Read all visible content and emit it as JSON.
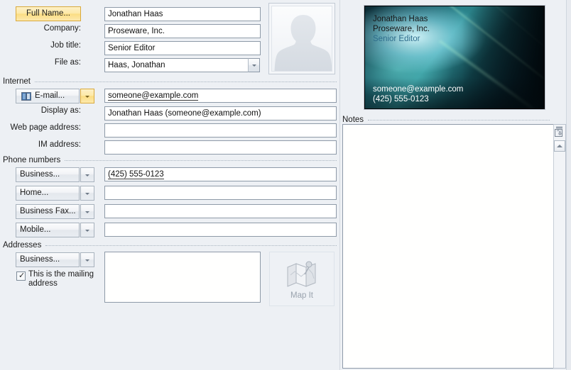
{
  "form": {
    "name_button": "Full Name...",
    "name_value": "Jonathan Haas",
    "company_label": "Company:",
    "company_value": "Proseware, Inc.",
    "jobtitle_label": "Job title:",
    "jobtitle_value": "Senior Editor",
    "fileas_label": "File as:",
    "fileas_value": "Haas, Jonathan"
  },
  "internet": {
    "section_label": "Internet",
    "email_button": "E-mail...",
    "email_icon": "address-book-icon",
    "email_value": "someone@example.com",
    "displayas_label": "Display as:",
    "displayas_value": "Jonathan Haas (someone@example.com)",
    "webpage_label": "Web page address:",
    "webpage_value": "",
    "im_label": "IM address:",
    "im_value": ""
  },
  "phones": {
    "section_label": "Phone numbers",
    "rows": [
      {
        "type": "Business...",
        "value": "(425) 555-0123",
        "smarttag": true
      },
      {
        "type": "Home...",
        "value": "",
        "smarttag": false
      },
      {
        "type": "Business Fax...",
        "value": "",
        "smarttag": false
      },
      {
        "type": "Mobile...",
        "value": "",
        "smarttag": false
      }
    ]
  },
  "addresses": {
    "section_label": "Addresses",
    "type": "Business...",
    "value": "",
    "mailing_checkbox_label": "This is the mailing address",
    "mailing_checked": true,
    "mapit_label": "Map It",
    "mapit_icon": "map-icon"
  },
  "photo": {
    "icon": "person-silhouette-icon"
  },
  "card": {
    "name": "Jonathan Haas",
    "company": "Proseware, Inc.",
    "title": "Senior Editor",
    "email": "someone@example.com",
    "phone": "(425) 555-0123",
    "title_color": "#2f6d8c"
  },
  "notes": {
    "section_label": "Notes",
    "value": "",
    "corner_icon": "note-options-icon",
    "scroll_up_icon": "scroll-up-arrow-icon"
  },
  "colors": {
    "background": "#edf0f4",
    "field_border": "#8e9aa8",
    "accent_amber": "#fbdd83"
  }
}
